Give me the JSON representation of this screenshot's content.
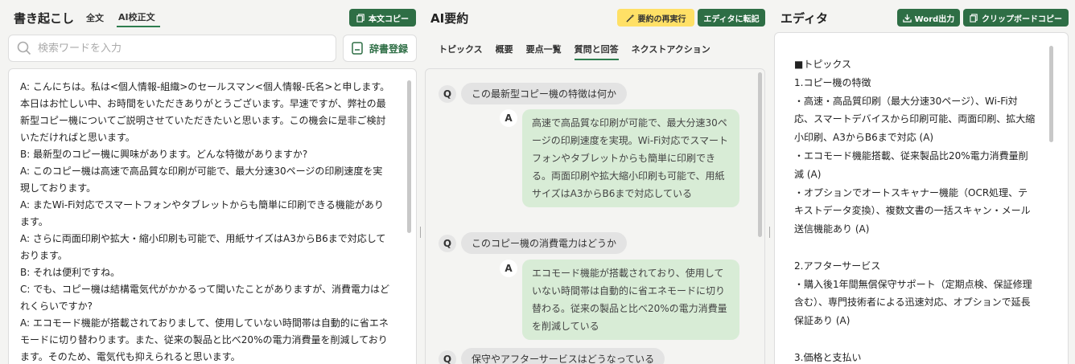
{
  "transcription": {
    "title": "書き起こし",
    "tabs": [
      "全文",
      "AI校正文"
    ],
    "active_tab": 1,
    "copy_button": "本文コピー",
    "search_placeholder": "検索ワードを入力",
    "dict_button": "辞書登録",
    "lines": [
      "A: こんにちは。私は<個人情報-組織>のセールスマン<個人情報-氏名>と申します。本日はお忙しい中、お時間をいただきありがとうございます。早速ですが、弊社の最新型コピー機についてご説明させていただきたいと思います。この機会に是非ご検討いただければと思います。",
      "B: 最新型のコピー機に興味があります。どんな特徴がありますか?",
      "A: このコピー機は高速で高品質な印刷が可能で、最大分速30ページの印刷速度を実現しております。",
      "A: またWi-Fi対応でスマートフォンやタブレットからも簡単に印刷できる機能があります。",
      "A: さらに両面印刷や拡大・縮小印刷も可能で、用紙サイズはA3からB6まで対応しております。",
      "B: それは便利ですね。",
      "C: でも、コピー機は結構電気代がかかるって聞いたことがありますが、消費電力はどれくらいですか?",
      "A: エコモード機能が搭載されておりまして、使用していない時間帯は自動的に省エネモードに切り替わります。また、従来の製品と比べ20%の電力消費量を削減しております。そのため、電気代も抑えられると思います。"
    ]
  },
  "summary": {
    "title": "AI要約",
    "rerun_button": "要約の再実行",
    "transfer_button": "エディタに転記",
    "tabs": [
      "トピックス",
      "概要",
      "要点一覧",
      "質問と回答",
      "ネクストアクション"
    ],
    "active_tab": 3,
    "qa": [
      {
        "q": "この最新型コピー機の特徴は何か",
        "a": "高速で高品質な印刷が可能で、最大分速30ページの印刷速度を実現。Wi-Fi対応でスマートフォンやタブレットからも簡単に印刷できる。両面印刷や拡大縮小印刷も可能で、用紙サイズはA3からB6まで対応している"
      },
      {
        "q": "このコピー機の消費電力はどうか",
        "a": "エコモード機能が搭載されており、使用していない時間帯は自動的に省エネモードに切り替わる。従来の製品と比べ20%の電力消費量を削減している"
      },
      {
        "q": "保守やアフターサービスはどうなっている",
        "a": ""
      }
    ],
    "q_label": "Q",
    "a_label": "A"
  },
  "editor": {
    "title": "エディタ",
    "word_button": "Word出力",
    "clipboard_button": "クリップボードコピー",
    "lines": [
      "■トピックス",
      "1.コピー機の特徴",
      "・高速・高品質印刷（最大分速30ページ）、Wi-Fi対応、スマートデバイスから印刷可能、両面印刷、拡大縮小印刷、A3からB6まで対応 (A)",
      "・エコモード機能搭載、従来製品比20%電力消費量削減 (A)",
      "・オプションでオートスキャナー機能（OCR処理、テキストデータ変換）、複数文書の一括スキャン・メール送信機能あり (A)",
      "",
      "2.アフターサービス",
      "・購入後1年間無償保守サポート（定期点検、保証修理含む）、専門技術者による迅速対応、オプションで延長保証あり (A)",
      "",
      "3.価格と支払い"
    ]
  }
}
